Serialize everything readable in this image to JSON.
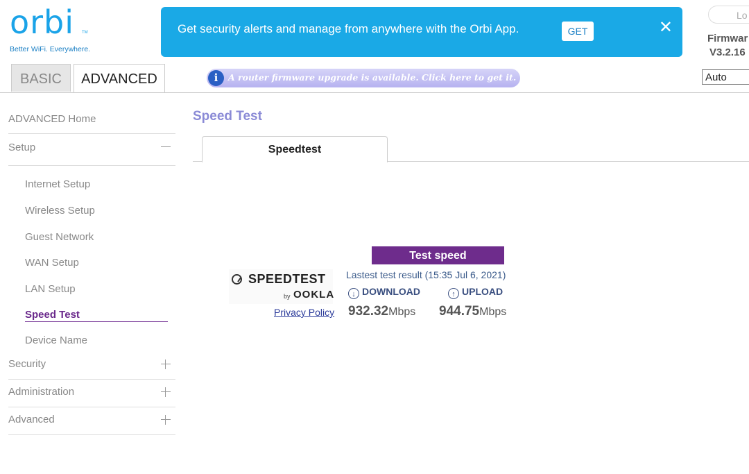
{
  "header": {
    "logo_word": "orbi",
    "logo_tm": "TM",
    "logo_tagline": "Better WiFi. Everywhere.",
    "banner_text": "Get security alerts and manage from anywhere with the Orbi App.",
    "banner_get_label": "GET",
    "banner_close_icon": "✕",
    "logout_label": "Lo",
    "firmware_label": "Firmwar",
    "firmware_version": "V3.2.16",
    "tabs": [
      {
        "label": "BASIC",
        "active": false
      },
      {
        "label": "ADVANCED",
        "active": true
      }
    ],
    "upgrade_notice": "A router firmware upgrade is available. Click here to get it.",
    "language_selected": "Auto"
  },
  "sidebar": {
    "home": "ADVANCED Home",
    "setup": {
      "label": "Setup",
      "toggle": "−",
      "items": [
        {
          "label": "Internet Setup"
        },
        {
          "label": "Wireless Setup"
        },
        {
          "label": "Guest Network"
        },
        {
          "label": "WAN Setup"
        },
        {
          "label": "LAN Setup"
        },
        {
          "label": "Speed Test",
          "active": true
        },
        {
          "label": "Device Name"
        }
      ]
    },
    "sections": [
      {
        "label": "Security"
      },
      {
        "label": "Administration"
      },
      {
        "label": "Advanced"
      }
    ]
  },
  "main": {
    "page_title": "Speed Test",
    "tab_label": "Speedtest",
    "test_button": "Test speed",
    "last_result": "Lastest test result (15:35 Jul 6, 2021)",
    "logo": {
      "word": "SPEEDTEST",
      "by": "by",
      "brand": "OOKLA"
    },
    "privacy_policy": "Privacy Policy",
    "download": {
      "label": "DOWNLOAD",
      "value": "932.32",
      "unit": "Mbps"
    },
    "upload": {
      "label": "UPLOAD",
      "value": "944.75",
      "unit": "Mbps"
    }
  },
  "colors": {
    "brand_blue": "#1aa3e8",
    "banner_blue": "#1aa9e6",
    "accent_purple": "#6e2c8c",
    "title_lavender": "#8a8ad6"
  }
}
